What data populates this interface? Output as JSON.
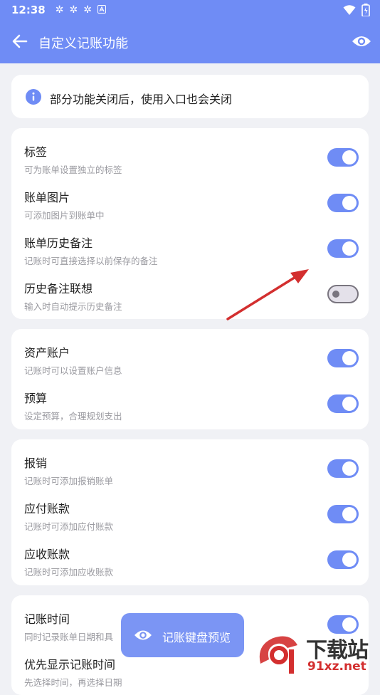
{
  "status": {
    "time": "12:38",
    "icons": [
      "gear-icon",
      "gear-icon",
      "gear-icon",
      "a-icon"
    ]
  },
  "appbar": {
    "title": "自定义记账功能"
  },
  "notice": {
    "text": "部分功能关闭后，使用入口也会关闭"
  },
  "groups": [
    [
      {
        "title": "标签",
        "subtitle": "可为账单设置独立的标签",
        "on": true
      },
      {
        "title": "账单图片",
        "subtitle": "可添加图片到账单中",
        "on": true
      },
      {
        "title": "账单历史备注",
        "subtitle": "记账时可直接选择以前保存的备注",
        "on": true
      },
      {
        "title": "历史备注联想",
        "subtitle": "输入时自动提示历史备注",
        "on": false
      }
    ],
    [
      {
        "title": "资产账户",
        "subtitle": "记账时可以设置账户信息",
        "on": true
      },
      {
        "title": "预算",
        "subtitle": "设定预算，合理规划支出",
        "on": true
      }
    ],
    [
      {
        "title": "报销",
        "subtitle": "记账时可添加报销账单",
        "on": true
      },
      {
        "title": "应付账款",
        "subtitle": "记账时可添加应付账款",
        "on": true
      },
      {
        "title": "应收账款",
        "subtitle": "记账时可添加应收账款",
        "on": true
      }
    ],
    [
      {
        "title": "记账时间",
        "subtitle": "同时记录账单日期和具",
        "on": true
      },
      {
        "title": "优先显示记账时间",
        "subtitle": "先选择时间，再选择日期",
        "on": true
      }
    ]
  ],
  "fab": {
    "label": "记账键盘预览"
  },
  "watermark": {
    "big": "下载站",
    "small": "91xz.net"
  },
  "colors": {
    "accent": "#6f8cf5",
    "toggle_off_bg": "#e4e1ea",
    "arrow": "#d32f2f"
  }
}
